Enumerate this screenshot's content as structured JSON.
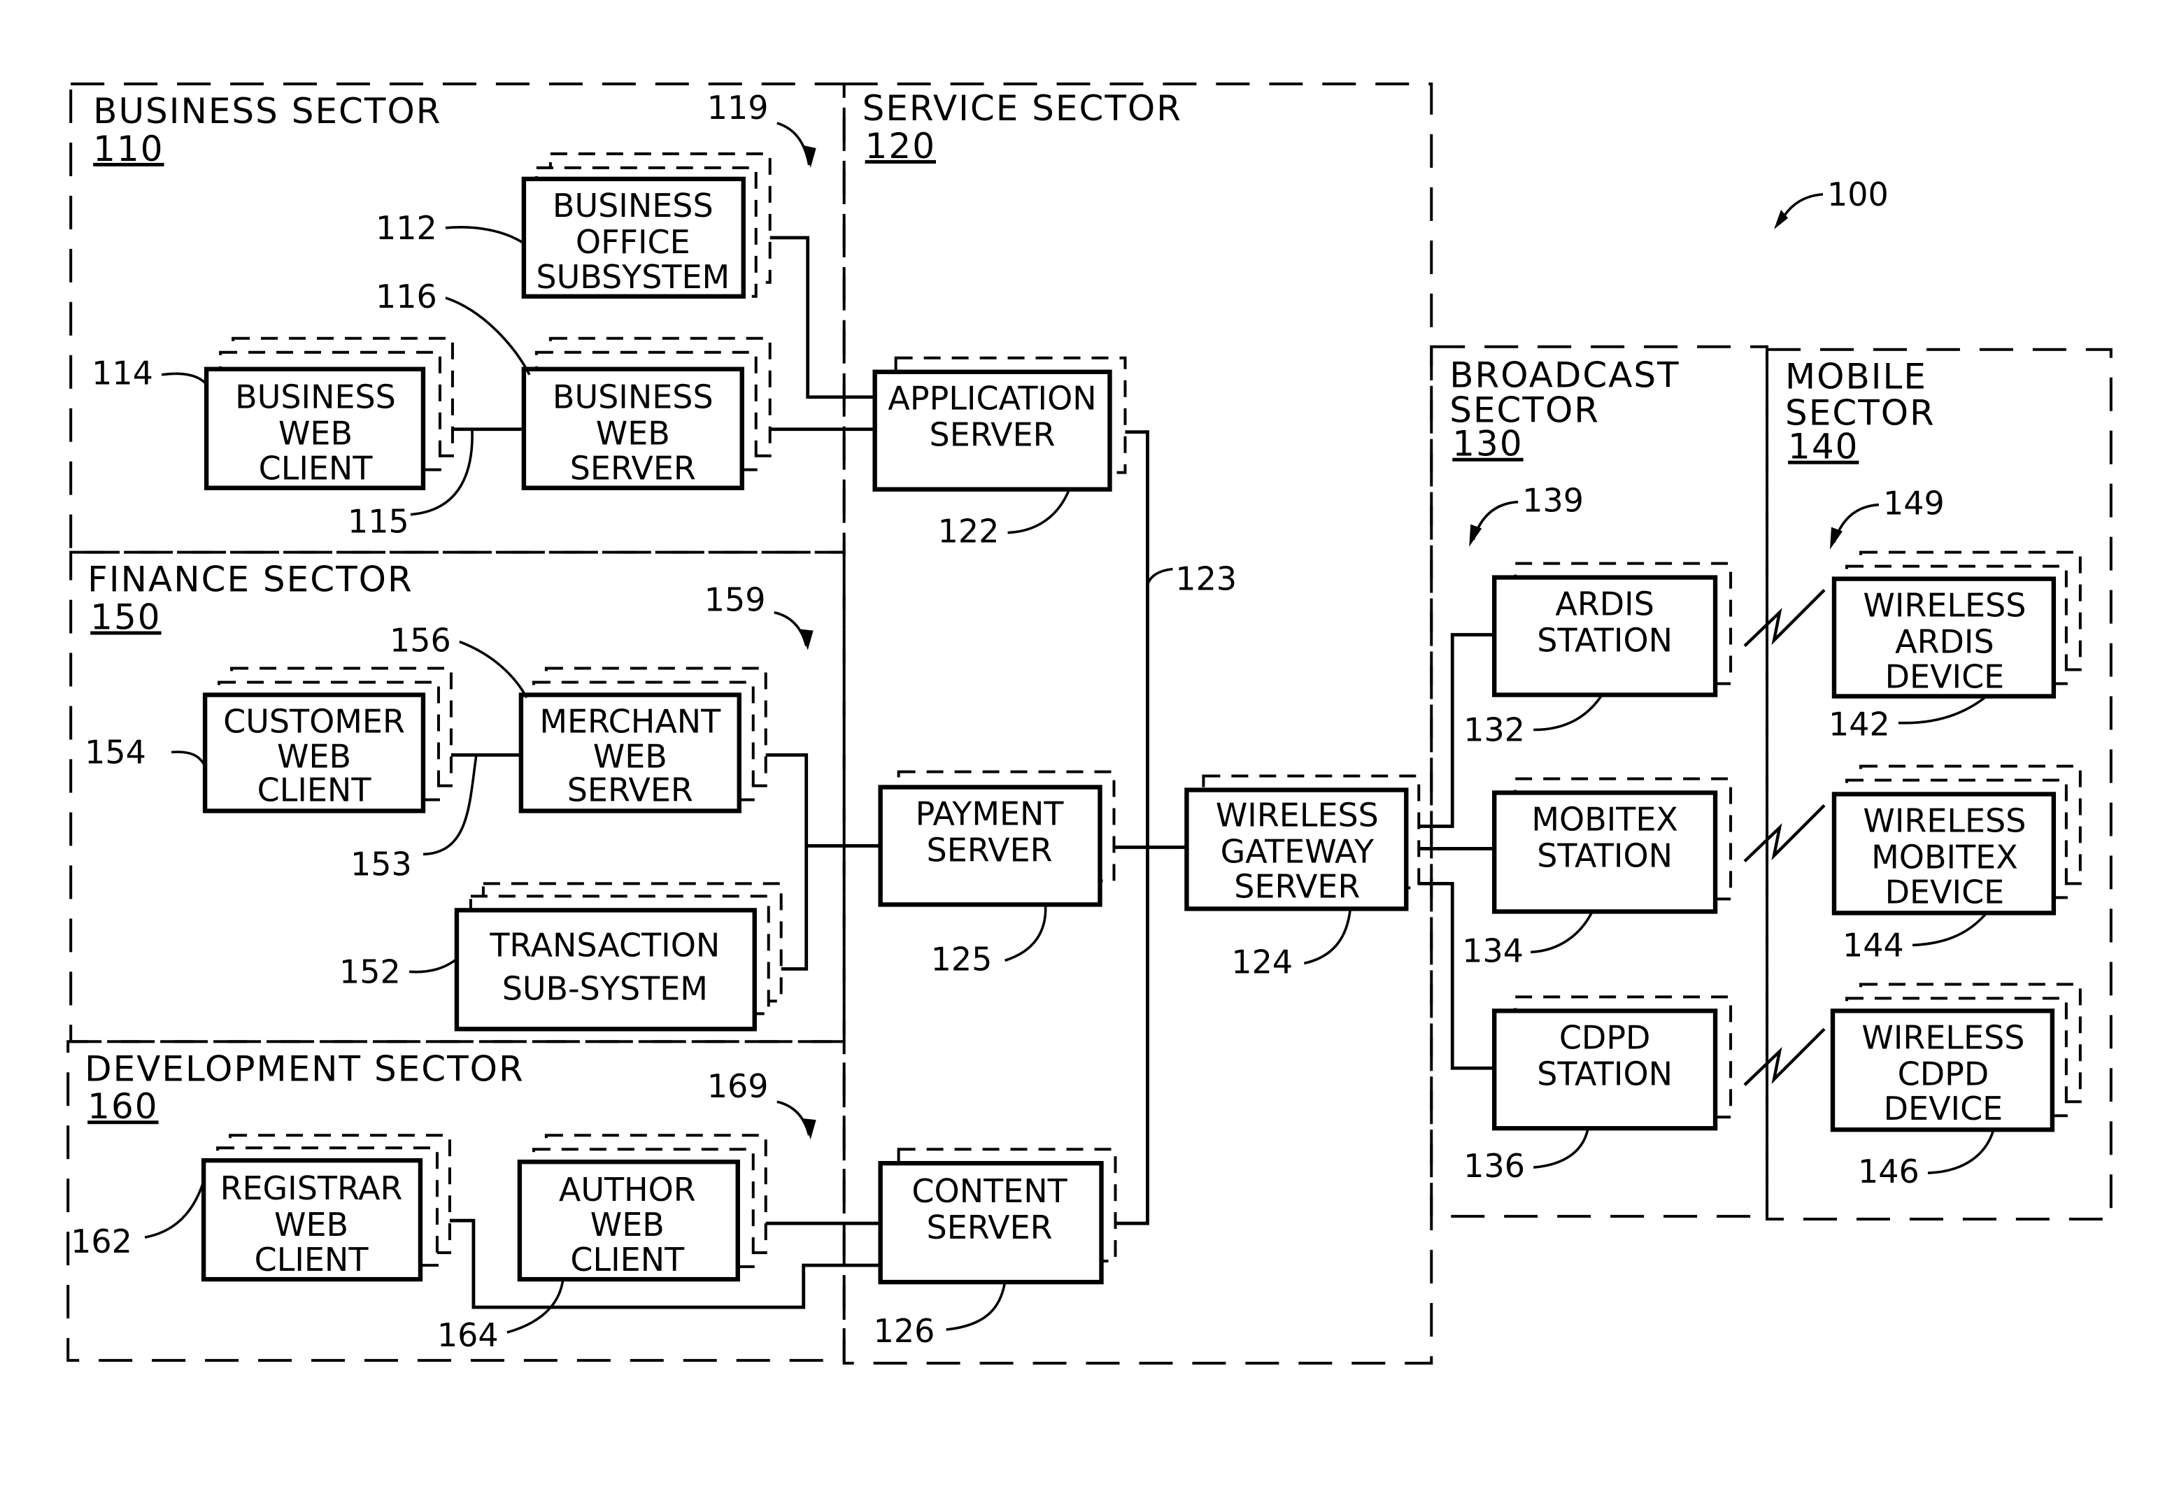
{
  "figure": {
    "reference": "100"
  },
  "sectors": {
    "business": {
      "title": "BUSINESS SECTOR",
      "ref": "110",
      "arrow_ref": "119"
    },
    "service": {
      "title": "SERVICE SECTOR",
      "ref": "120"
    },
    "finance": {
      "title": "FINANCE SECTOR",
      "ref": "150",
      "arrow_ref": "159"
    },
    "development": {
      "title": "DEVELOPMENT SECTOR",
      "ref": "160",
      "arrow_ref": "169"
    },
    "broadcast": {
      "title_line1": "BROADCAST",
      "title_line2": "SECTOR",
      "ref": "130",
      "arrow_ref": "139"
    },
    "mobile": {
      "title_line1": "MOBILE",
      "title_line2": "SECTOR",
      "ref": "140",
      "arrow_ref": "149"
    }
  },
  "components": {
    "business_office": {
      "lines": [
        "BUSINESS",
        "OFFICE",
        "SUBSYSTEM"
      ],
      "ref": "112"
    },
    "business_client": {
      "lines": [
        "BUSINESS",
        "WEB",
        "CLIENT"
      ],
      "ref": "114"
    },
    "business_server": {
      "lines": [
        "BUSINESS",
        "WEB",
        "SERVER"
      ],
      "ref": "116"
    },
    "business_link": {
      "ref": "115"
    },
    "application_server": {
      "lines": [
        "APPLICATION",
        "SERVER"
      ],
      "ref": "122"
    },
    "backbone": {
      "ref": "123"
    },
    "customer_client": {
      "lines": [
        "CUSTOMER",
        "WEB",
        "CLIENT"
      ],
      "ref": "154"
    },
    "merchant_server": {
      "lines": [
        "MERCHANT",
        "WEB",
        "SERVER"
      ],
      "ref": "156"
    },
    "finance_link": {
      "ref": "153"
    },
    "transaction": {
      "lines": [
        "TRANSACTION",
        "SUB-SYSTEM"
      ],
      "ref": "152"
    },
    "payment_server": {
      "lines": [
        "PAYMENT",
        "SERVER"
      ],
      "ref": "125"
    },
    "gateway_server": {
      "lines": [
        "WIRELESS",
        "GATEWAY",
        "SERVER"
      ],
      "ref": "124"
    },
    "registrar_client": {
      "lines": [
        "REGISTRAR",
        "WEB",
        "CLIENT"
      ],
      "ref": "162"
    },
    "author_client": {
      "lines": [
        "AUTHOR",
        "WEB",
        "CLIENT"
      ],
      "ref": "164"
    },
    "content_server": {
      "lines": [
        "CONTENT",
        "SERVER"
      ],
      "ref": "126"
    },
    "ardis_station": {
      "lines": [
        "ARDIS",
        "STATION"
      ],
      "ref": "132"
    },
    "mobitex_station": {
      "lines": [
        "MOBITEX",
        "STATION"
      ],
      "ref": "134"
    },
    "cdpd_station": {
      "lines": [
        "CDPD",
        "STATION"
      ],
      "ref": "136"
    },
    "ardis_device": {
      "lines": [
        "WIRELESS",
        "ARDIS",
        "DEVICE"
      ],
      "ref": "142"
    },
    "mobitex_device": {
      "lines": [
        "WIRELESS",
        "MOBITEX",
        "DEVICE"
      ],
      "ref": "144"
    },
    "cdpd_device": {
      "lines": [
        "WIRELESS",
        "CDPD",
        "DEVICE"
      ],
      "ref": "146"
    }
  }
}
